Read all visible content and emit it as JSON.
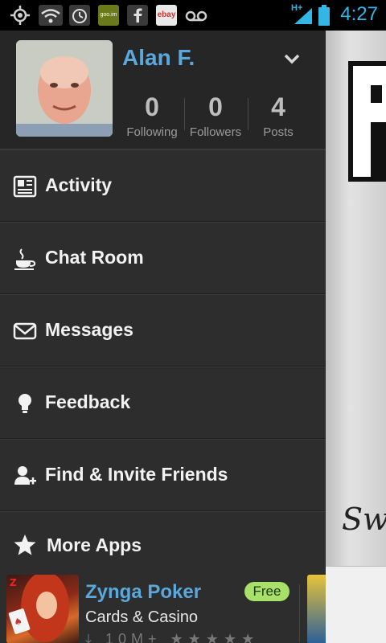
{
  "status_bar": {
    "time": "4:27",
    "network": "H+",
    "icons": [
      "gps-icon",
      "wifi-icon",
      "alarm-icon",
      "goo-app-icon",
      "facebook-icon",
      "ebay-icon",
      "voicemail-icon",
      "signal-icon",
      "battery-icon"
    ],
    "goo_label": "goo.im",
    "ebay_label": "ebay"
  },
  "profile": {
    "name": "Alan F.",
    "stats": [
      {
        "value": "0",
        "label": "Following"
      },
      {
        "value": "0",
        "label": "Followers"
      },
      {
        "value": "4",
        "label": "Posts"
      }
    ]
  },
  "menu": {
    "items": [
      {
        "label": "Activity",
        "icon": "newspaper-icon"
      },
      {
        "label": "Chat Room",
        "icon": "coffee-cup-icon"
      },
      {
        "label": "Messages",
        "icon": "envelope-icon"
      },
      {
        "label": "Feedback",
        "icon": "lightbulb-icon"
      },
      {
        "label": "Find & Invite Friends",
        "icon": "add-person-icon"
      }
    ],
    "more_apps_label": "More Apps"
  },
  "promo_app": {
    "title": "Zynga Poker",
    "subtitle": "Cards & Casino",
    "price_badge": "Free",
    "downloads": "10M+",
    "stars": "★★★★★"
  },
  "background_app": {
    "script_text": "Swi"
  },
  "colors": {
    "accent": "#5aa8dc",
    "status_blue": "#33b5e5",
    "drawer_bg": "#2b2b2b",
    "free_badge": "#a8e06a"
  }
}
